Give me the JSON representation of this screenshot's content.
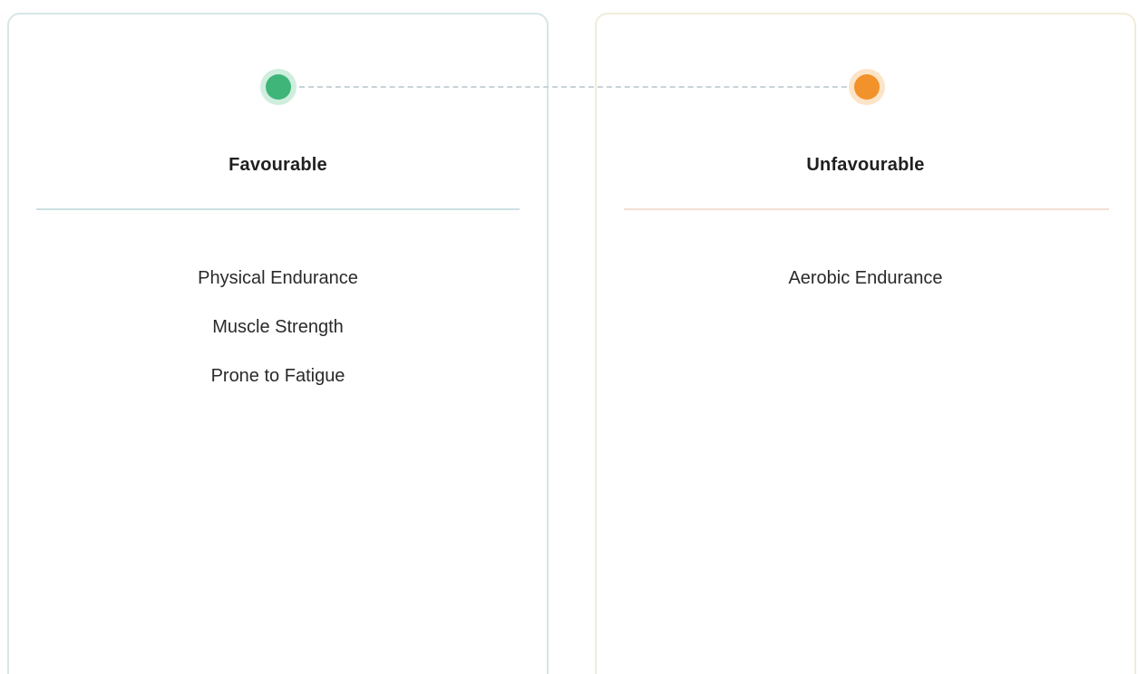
{
  "favourable": {
    "title": "Favourable",
    "color": "#3fb57a",
    "items": [
      "Physical Endurance",
      "Muscle Strength",
      "Prone to Fatigue"
    ]
  },
  "unfavourable": {
    "title": "Unfavourable",
    "color": "#f2922a",
    "items": [
      "Aerobic Endurance"
    ]
  }
}
